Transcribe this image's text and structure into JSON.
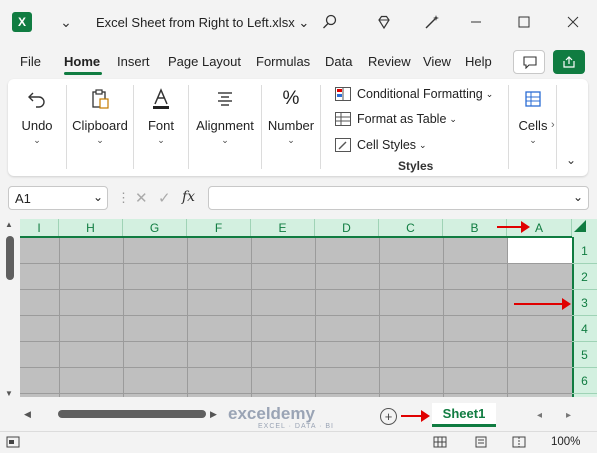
{
  "window": {
    "app_icon": "excel-icon",
    "app_letter": "X",
    "title": "Excel Sheet from Right to Left.xlsx",
    "controls": [
      "minimize-icon",
      "maximize-icon",
      "close-icon"
    ]
  },
  "menu": {
    "tabs": [
      {
        "label": "File",
        "active": false
      },
      {
        "label": "Home",
        "active": true
      },
      {
        "label": "Insert",
        "active": false
      },
      {
        "label": "Page Layout",
        "active": false
      },
      {
        "label": "Formulas",
        "active": false
      },
      {
        "label": "Data",
        "active": false
      },
      {
        "label": "Review",
        "active": false
      },
      {
        "label": "View",
        "active": false
      },
      {
        "label": "Help",
        "active": false
      }
    ]
  },
  "ribbon": {
    "undo": "Undo",
    "clipboard": "Clipboard",
    "font": "Font",
    "alignment": "Alignment",
    "number": "Number",
    "number_symbol": "%",
    "conditional_formatting": "Conditional Formatting",
    "format_as_table": "Format as Table",
    "cell_styles": "Cell Styles",
    "styles_group": "Styles",
    "cells": "Cells"
  },
  "formula_bar": {
    "name_box": "A1",
    "fx": "fx",
    "formula": ""
  },
  "grid": {
    "columns": [
      "I",
      "H",
      "G",
      "F",
      "E",
      "D",
      "C",
      "B",
      "A"
    ],
    "rows": [
      "1",
      "2",
      "3",
      "4",
      "5",
      "6"
    ],
    "selected_cell": "A1",
    "direction": "right-to-left"
  },
  "sheets": {
    "tabs": [
      "Sheet1"
    ],
    "active": "Sheet1"
  },
  "watermark": {
    "name": "exceldemy",
    "tagline": "EXCEL · DATA · BI"
  },
  "status": {
    "zoom": "100%"
  },
  "colors": {
    "accent": "#107c41",
    "header_fill": "#d3f0e0",
    "annotation_arrow": "#e00000",
    "grid_fill": "#bfbfbf"
  }
}
